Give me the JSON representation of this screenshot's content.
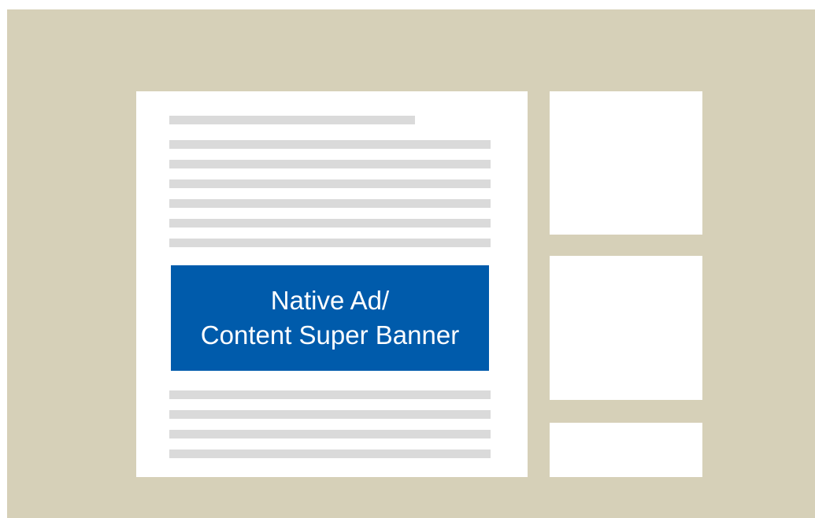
{
  "ad_banner": {
    "line1": "Native Ad/",
    "line2": "Content Super Banner"
  },
  "colors": {
    "page_background": "#d6d0b8",
    "panel": "#ffffff",
    "text_placeholder": "#dadada",
    "ad_background": "#005bab",
    "ad_text": "#ffffff"
  }
}
